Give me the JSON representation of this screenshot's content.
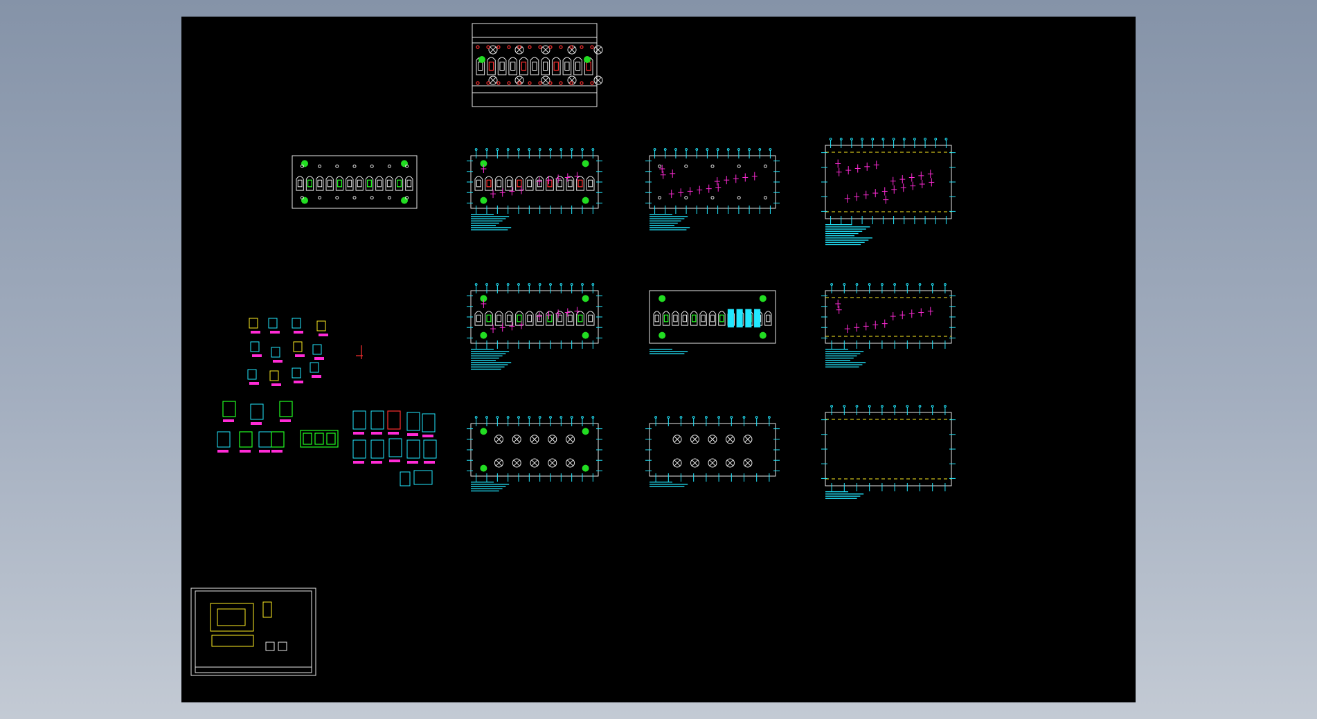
{
  "app": {
    "view": "2D model space",
    "background": "#000000",
    "frame_background": "#8e9bb0"
  },
  "palette": {
    "outline": "#e8e8e8",
    "green": "#22ff22",
    "cyan": "#22e8ff",
    "magenta": "#ff2bd6",
    "red": "#ff3030",
    "yellow": "#ffee22"
  },
  "drawing": {
    "title_block": "",
    "notes": []
  }
}
